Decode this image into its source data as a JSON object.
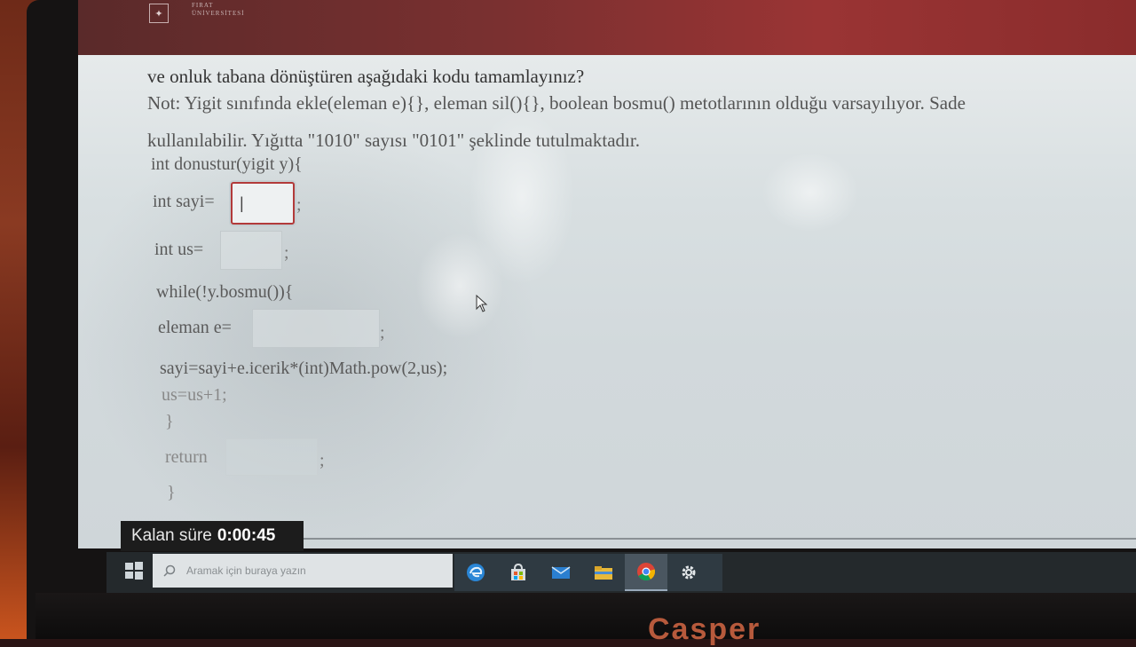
{
  "header": {
    "university_logo_text_line1": "FIRAT",
    "university_logo_text_line2": "ÜNİVERSİTESİ"
  },
  "question": {
    "line1": "ve onluk tabana dönüştüren aşağıdaki kodu tamamlayınız?",
    "line2": "Not: Yigit sınıfında ekle(eleman e){}, eleman sil(){}, boolean bosmu() metotlarının olduğu varsayılıyor. Sade",
    "line3": "kullanılabilir. Yığıtta \"1010\" sayısı \"0101\" şeklinde tutulmaktadır."
  },
  "code": {
    "signature": "int donustur(yigit y){",
    "sayi_decl": "int sayi=",
    "us_decl": "int us=",
    "while_line": "while(!y.bosmu()){",
    "eleman_decl": "eleman e=",
    "sayi_update": "sayi=sayi+e.icerik*(int)Math.pow(2,us);",
    "us_update": "us=us+1;",
    "close_while": "}",
    "return_kw": "return",
    "close_func": "}",
    "semicolon": ";"
  },
  "blanks": {
    "sayi_value": "|",
    "us_value": "",
    "eleman_value": "",
    "return_value": ""
  },
  "timer": {
    "label": "Kalan süre",
    "value": "0:00:45"
  },
  "taskbar": {
    "search_placeholder": "Aramak için buraya yazın",
    "icons": [
      "windows-start-icon",
      "search-icon",
      "edge-icon",
      "store-icon",
      "mail-icon",
      "file-explorer-icon",
      "chrome-icon",
      "settings-icon"
    ]
  },
  "device": {
    "brand": "Casper"
  },
  "colors": {
    "focus_border": "#b23a3a",
    "taskbar_bg": "#24292c",
    "timer_bg": "#1c1c1c"
  }
}
